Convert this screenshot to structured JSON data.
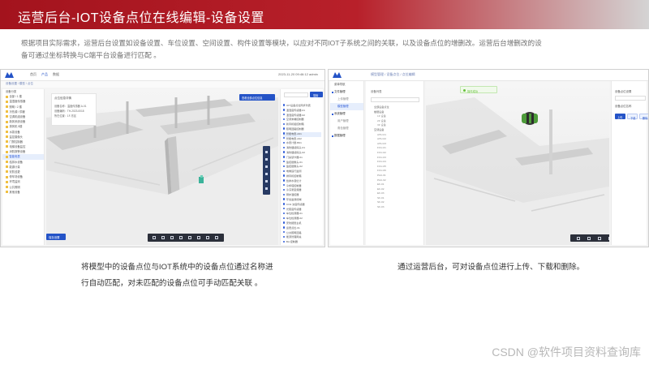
{
  "header": {
    "title": "运营后台-IOT设备点位在线编辑-设备设置"
  },
  "intro": {
    "line1": "根据项目实际需求，运营后台设置如设备设置、车位设置、空间设置、构件设置等模块，以应对不同IOT子系统之间的关联，以及设备点位的增删改。运营后台增删改的设",
    "line2": "备可通过坐标转换与C端平台设备进行匹配 。"
  },
  "left_screen": {
    "topbar": {
      "nav_a": "首页",
      "nav_b": "产品",
      "nav_c": "数据",
      "time": "2023-11-20 09:46:12",
      "user": "admin"
    },
    "breadcrumb": "设备设置 / 模型 / 点位",
    "tree": [
      {
        "label": "设备分类"
      },
      {
        "label": "全部 / 1 楼"
      },
      {
        "label": "温湿度传感器"
      },
      {
        "label": "照明 / 2 楼"
      },
      {
        "label": "冷热源 / 供暖"
      },
      {
        "label": "空调机组设备"
      },
      {
        "label": "新风系统设备"
      },
      {
        "label": "排风机 5楼"
      },
      {
        "label": "水泵设备"
      },
      {
        "label": "监控摄像头"
      },
      {
        "label": "门禁控制器"
      },
      {
        "label": "电梯设备监控"
      },
      {
        "label": "消防报警设备"
      },
      {
        "label": "智能电表"
      },
      {
        "label": "给排水设备"
      },
      {
        "label": "能源计量"
      },
      {
        "label": "安防巡更"
      },
      {
        "label": "停车场设备"
      },
      {
        "label": "环境监测"
      },
      {
        "label": "公共照明"
      },
      {
        "label": "其他设备"
      }
    ],
    "float_card": {
      "title": "点位信息详情",
      "row1": "设备名称：温度传感器 A-01",
      "row2": "设备编码：TH-2023-0018",
      "row3": "所在位置：1F-东区"
    },
    "tag_label": "查看全部点位信息",
    "bottom_button": "保存设置",
    "search_button": "搜索",
    "points": [
      {
        "label": "IOT设备点位同步列表"
      },
      {
        "label": "温湿度传感器-01"
      },
      {
        "label": "温湿度传感器-02"
      },
      {
        "label": "空调末端控制器"
      },
      {
        "label": "新风机组控制箱"
      },
      {
        "label": "照明回路控制器"
      },
      {
        "label": "智能电表-A01"
      },
      {
        "label": "智能电表-A02"
      },
      {
        "label": "水表计量-B01"
      },
      {
        "label": "消防烟感探头-01"
      },
      {
        "label": "消防烟感探头-02"
      },
      {
        "label": "门禁读卡器-01"
      },
      {
        "label": "监控摄像头-01"
      },
      {
        "label": "监控摄像头-02"
      },
      {
        "label": "电梯运行监测"
      },
      {
        "label": "排风机控制箱"
      },
      {
        "label": "给排水液位计"
      },
      {
        "label": "冷却塔控制器"
      },
      {
        "label": "冷冻泵变频器"
      },
      {
        "label": "锅炉温控器"
      },
      {
        "label": "环境监测终端"
      },
      {
        "label": "CO2 浓度传感器"
      },
      {
        "label": "光照度传感器"
      },
      {
        "label": "车位检测器-01"
      },
      {
        "label": "车位检测器-02"
      },
      {
        "label": "安防报警主机"
      },
      {
        "label": "巡更点位-01"
      },
      {
        "label": "公共照明回路"
      },
      {
        "label": "能源管理网关"
      },
      {
        "label": "BA 控制器"
      }
    ]
  },
  "right_screen": {
    "menu": [
      {
        "label": "菜单导航",
        "kind": "title"
      },
      {
        "label": "文件管理",
        "kind": "group"
      },
      {
        "label": "上传管理",
        "kind": "sub"
      },
      {
        "label": "模型管理",
        "kind": "sub active"
      },
      {
        "label": "系统管理",
        "kind": "group"
      },
      {
        "label": "用户管理",
        "kind": "sub"
      },
      {
        "label": "角色管理",
        "kind": "sub"
      },
      {
        "label": "数据管理",
        "kind": "group"
      }
    ],
    "breadcrumb": "模型管理 / 设备点位 / 点位编辑",
    "tree_title": "设备列表",
    "tree": [
      {
        "label": "全部设备点位",
        "level": "l2"
      },
      {
        "label": "楼层设备",
        "level": "l2"
      },
      {
        "label": "1F 设备",
        "level": "l3"
      },
      {
        "label": "2F 设备",
        "level": "l3"
      },
      {
        "label": "3F 设备",
        "level": "l3"
      },
      {
        "label": "空调设备",
        "level": "l2"
      },
      {
        "label": "AHU-01",
        "level": "l3"
      },
      {
        "label": "AHU-02",
        "level": "l3"
      },
      {
        "label": "AHU-03",
        "level": "l3"
      },
      {
        "label": "FCU-01",
        "level": "l3"
      },
      {
        "label": "FCU-02",
        "level": "l3"
      },
      {
        "label": "FCU-03",
        "level": "l3"
      },
      {
        "label": "FCU-04",
        "level": "l3"
      },
      {
        "label": "FCU-05",
        "level": "l3"
      },
      {
        "label": "FCU-06",
        "level": "l3"
      },
      {
        "label": "PAU-01",
        "level": "l3"
      },
      {
        "label": "PAU-02",
        "level": "l3"
      },
      {
        "label": "EF-01",
        "level": "l3"
      },
      {
        "label": "EF-02",
        "level": "l3"
      },
      {
        "label": "EF-03",
        "level": "l3"
      },
      {
        "label": "SF-01",
        "level": "l3"
      },
      {
        "label": "SF-02",
        "level": "l3"
      },
      {
        "label": "SF-03",
        "level": "l3"
      }
    ],
    "toast": "操作成功",
    "form": {
      "title": "设备点位设置",
      "label": "设备点位名称",
      "upload": "上传",
      "download": "下载",
      "delete": "删除"
    }
  },
  "captions": {
    "left_line1": "将模型中的设备点位与IOT系统中的设备点位通过名称进",
    "left_line2": "行自动匹配，对未匹配的设备点位可手动匹配关联 。",
    "right_line1": "通过运营后台，可对设备点位进行上传、下载和删除。"
  },
  "watermark": "CSDN @软件项目资料查询库"
}
